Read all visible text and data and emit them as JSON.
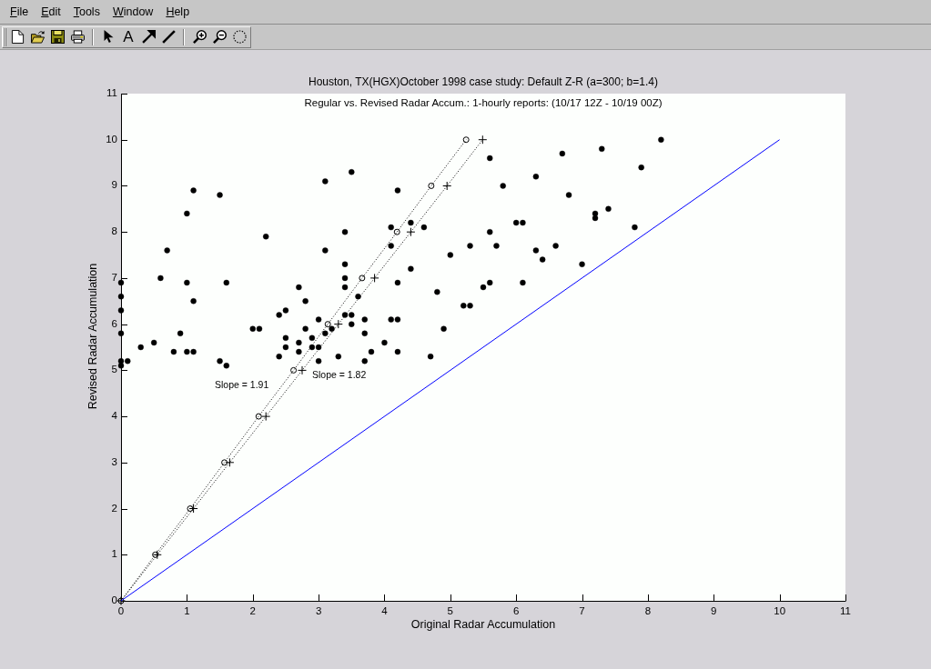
{
  "menu_bar": {
    "items": [
      "File",
      "Edit",
      "Tools",
      "Window",
      "Help"
    ]
  },
  "toolbar": {
    "text_button": "A"
  },
  "figure": {
    "chart_data": {
      "type": "scatter",
      "title": "Houston, TX(HGX)October 1998 case study: Default Z-R (a=300; b=1.4)",
      "subtitle": "Regular vs. Revised Radar Accum.: 1-hourly reports: (10/17 12Z - 10/19 00Z)",
      "xlabel": "Original Radar Accumulation",
      "ylabel": "Revised Radar Accumulation",
      "xlim": [
        0,
        11
      ],
      "ylim": [
        0,
        11
      ],
      "xticks": [
        0,
        1,
        2,
        3,
        4,
        5,
        6,
        7,
        8,
        9,
        10,
        11
      ],
      "yticks": [
        0,
        1,
        2,
        3,
        4,
        5,
        6,
        7,
        8,
        9,
        10,
        11
      ],
      "series": [
        {
          "type": "scatter",
          "marker": "circle",
          "color": "#000000",
          "x": [
            0,
            0,
            0,
            0,
            0,
            0,
            0.1,
            1.1,
            1.5,
            1.0,
            2.2,
            0.7,
            0.6,
            1.0,
            1.6,
            1.1,
            0.9,
            0.5,
            0.3,
            0.8,
            1.0,
            1.1,
            1.5,
            1.6,
            2.0,
            2.1,
            2.4,
            2.5,
            2.5,
            2.5,
            2.4,
            2.7,
            2.8,
            2.7,
            2.7,
            2.8,
            2.9,
            2.9,
            3.0,
            3.0,
            3.0,
            3.1,
            3.1,
            3.1,
            3.2,
            3.3,
            3.4,
            3.4,
            3.4,
            3.4,
            3.4,
            3.5,
            3.5,
            3.5,
            3.6,
            3.7,
            3.7,
            3.7,
            3.8,
            4.0,
            4.1,
            4.1,
            4.1,
            4.2,
            4.2,
            4.2,
            4.2,
            4.4,
            4.4,
            4.6,
            4.8,
            4.9,
            4.7,
            5.0,
            5.2,
            5.3,
            5.3,
            5.5,
            5.6,
            6.7,
            7.3,
            8.2,
            7.9,
            6.3,
            5.8,
            6.8,
            7.4,
            7.2,
            7.2,
            7.8,
            6.0,
            6.1,
            5.6,
            5.7,
            6.6,
            6.3,
            6.4,
            7.0,
            5.6,
            6.1
          ],
          "values": [
            6.9,
            6.6,
            6.3,
            5.8,
            5.2,
            5.1,
            5.2,
            8.9,
            8.8,
            8.4,
            7.9,
            7.6,
            7.0,
            6.9,
            6.9,
            6.5,
            5.8,
            5.6,
            5.5,
            5.4,
            5.4,
            5.4,
            5.2,
            5.1,
            5.9,
            5.9,
            6.2,
            6.3,
            5.7,
            5.5,
            5.3,
            6.8,
            6.5,
            5.6,
            5.4,
            5.9,
            5.7,
            5.5,
            6.1,
            5.5,
            5.2,
            9.1,
            7.6,
            5.8,
            5.9,
            5.3,
            8.0,
            7.3,
            7.0,
            6.8,
            6.2,
            9.3,
            6.2,
            6.0,
            6.6,
            6.1,
            5.8,
            5.2,
            5.4,
            5.6,
            8.1,
            7.7,
            6.1,
            8.9,
            6.9,
            6.1,
            5.4,
            8.2,
            7.2,
            8.1,
            6.7,
            5.9,
            5.3,
            7.5,
            6.4,
            6.4,
            7.7,
            6.8,
            9.6,
            9.7,
            9.8,
            10.0,
            9.4,
            9.2,
            9.0,
            8.8,
            8.5,
            8.4,
            8.3,
            8.1,
            8.2,
            8.2,
            8.0,
            7.7,
            7.7,
            7.6,
            7.4,
            7.3,
            6.9,
            6.9
          ]
        },
        {
          "type": "line",
          "marker": "circle",
          "line_style": "dotted",
          "color": "#000000",
          "x": [
            0,
            0.52,
            1.05,
            1.57,
            2.09,
            2.62,
            3.14,
            3.66,
            4.19,
            4.71,
            5.24
          ],
          "values": [
            0,
            1,
            2,
            3,
            4,
            5,
            6,
            7,
            8,
            9,
            10
          ]
        },
        {
          "type": "line",
          "marker": "cross",
          "line_style": "dotted",
          "color": "#000000",
          "x": [
            0,
            0.55,
            1.1,
            1.65,
            2.2,
            2.75,
            3.3,
            3.85,
            4.4,
            4.95,
            5.49
          ],
          "values": [
            0,
            1,
            2,
            3,
            4,
            5,
            6,
            7,
            8,
            9,
            10
          ]
        },
        {
          "type": "line",
          "line_style": "solid",
          "color": "#0000ff",
          "x": [
            0,
            10
          ],
          "values": [
            0,
            10
          ]
        }
      ],
      "annotations": [
        "Slope = 1.91",
        "Slope = 1.82"
      ]
    }
  }
}
